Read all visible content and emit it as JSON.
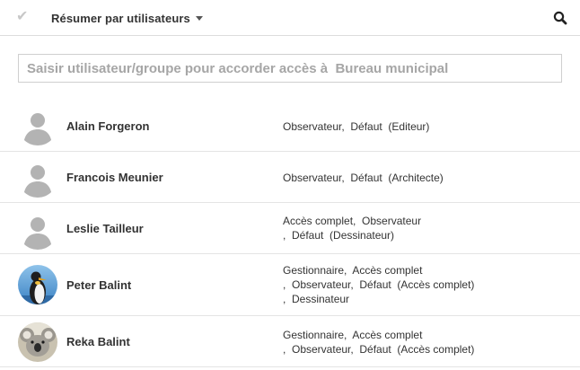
{
  "toolbar": {
    "check_icon": "check-icon",
    "summary_label": "Résumer par utilisateurs",
    "summary_caret_icon": "caret-down-icon",
    "search_icon": "search-icon"
  },
  "access_input": {
    "placeholder": "Saisir utilisateur/groupe pour accorder accès à  Bureau municipal",
    "value": ""
  },
  "users": [
    {
      "name": "Alain Forgeron",
      "avatar": "default-user-avatar",
      "role_lines": [
        "Observateur,  Défaut  (Editeur)"
      ]
    },
    {
      "name": "Francois Meunier",
      "avatar": "default-user-avatar",
      "role_lines": [
        "Observateur,  Défaut  (Architecte)"
      ]
    },
    {
      "name": "Leslie Tailleur",
      "avatar": "default-user-avatar",
      "role_lines": [
        "Accès complet,  Observateur",
        ",  Défaut  (Dessinateur)"
      ]
    },
    {
      "name": "Peter Balint",
      "avatar": "penguin-photo-avatar",
      "role_lines": [
        "Gestionnaire,  Accès complet",
        ",  Observateur,  Défaut  (Accès complet)",
        ",  Dessinateur"
      ]
    },
    {
      "name": "Reka Balint",
      "avatar": "koala-photo-avatar",
      "role_lines": [
        "Gestionnaire,  Accès complet",
        ",  Observateur,  Défaut  (Accès complet)"
      ]
    }
  ]
}
